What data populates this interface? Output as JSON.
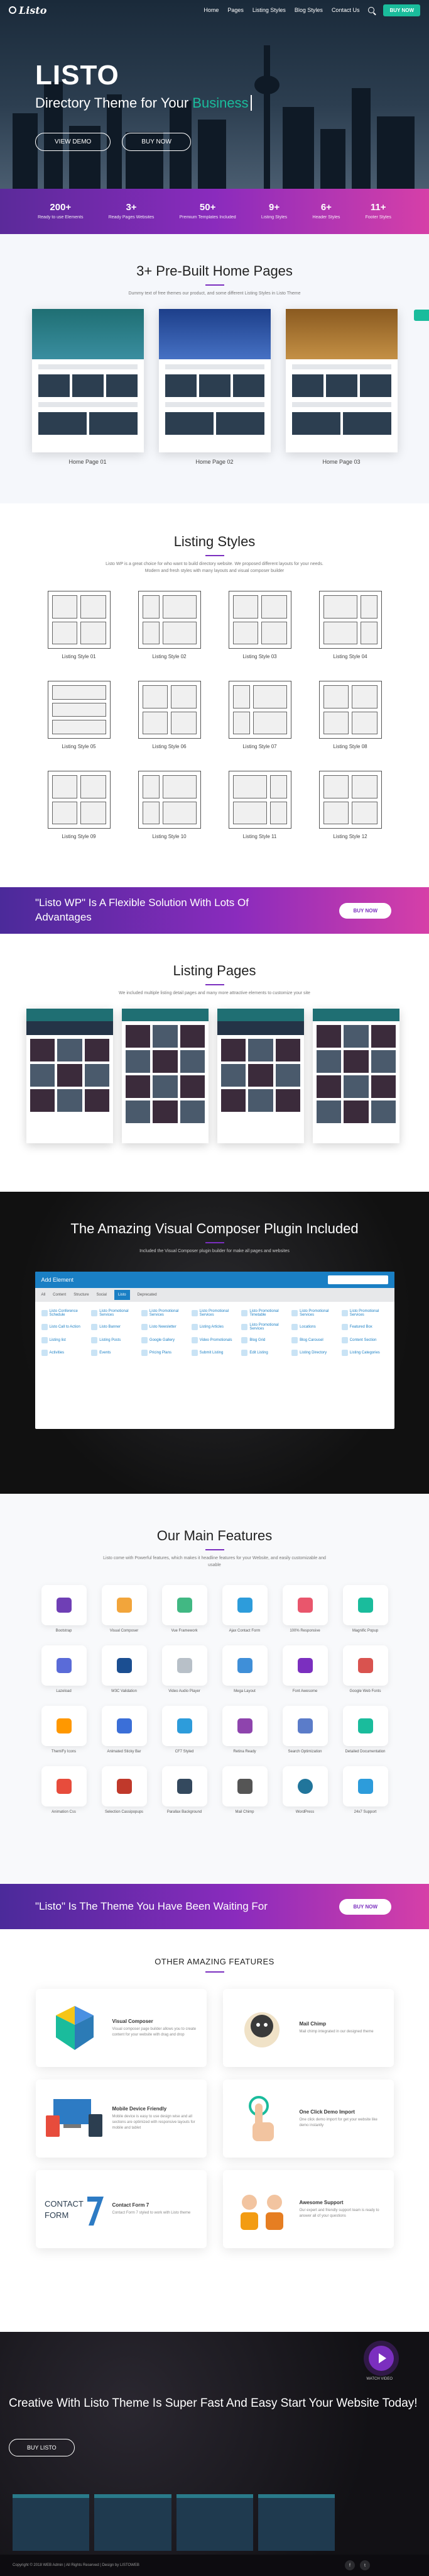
{
  "nav": {
    "logo": "Listo",
    "links": [
      "Home",
      "Pages",
      "Listing Styles",
      "Blog Styles",
      "Contact Us"
    ],
    "buy_label": "BUY NOW"
  },
  "hero": {
    "title": "LISTO",
    "subtitle": "Directory Theme for Your",
    "typed": "Business",
    "btn_demo": "VIEW DEMO",
    "btn_buy": "BUY NOW"
  },
  "stats": [
    {
      "n": "200+",
      "l": "Ready to use Elements"
    },
    {
      "n": "3+",
      "l": "Ready Pages Websites"
    },
    {
      "n": "50+",
      "l": "Premium Templates Included"
    },
    {
      "n": "9+",
      "l": "Listing Styles"
    },
    {
      "n": "6+",
      "l": "Header Styles"
    },
    {
      "n": "11+",
      "l": "Footer Styles"
    }
  ],
  "homepages": {
    "title": "3+ Pre-Built Home Pages",
    "desc": "Dummy text of free themes our product, and some different Listing Styles in Listo Theme",
    "items": [
      "Home Page 01",
      "Home Page 02",
      "Home Page 03"
    ]
  },
  "listing_styles": {
    "title": "Listing Styles",
    "desc": "Listo WP is a great choice for who want to build directory website. We proposed different layouts for your needs. Modern and fresh styles with many layouts and visual composer builder",
    "items": [
      "Listing Style 01",
      "Listing Style 02",
      "Listing Style 03",
      "Listing Style 04",
      "Listing Style 05",
      "Listing Style 06",
      "Listing Style 07",
      "Listing Style 08",
      "Listing Style 09",
      "Listing Style 10",
      "Listing Style 11",
      "Listing Style 12"
    ]
  },
  "cta1": {
    "text": "\"Listo WP\" Is A Flexible Solution With Lots Of Advantages",
    "btn": "BUY NOW"
  },
  "listing_pages": {
    "title": "Listing Pages",
    "desc": "We included multiple listing detail pages and many more attractive elements to customize your site"
  },
  "composer": {
    "title": "The Amazing Visual Composer Plugin Included",
    "desc": "Included the Visual Composer plugin builder for make all pages and websites",
    "window_title": "Add Element",
    "tabs": [
      "All",
      "Content",
      "Structure",
      "Social",
      "Listo",
      "Deprecated"
    ],
    "items": [
      "Listo Conference Schedule",
      "Listo Promotional Services",
      "Listo Promotional Services",
      "Listo Promotional Services",
      "Listo Promotional Timetable",
      "Listo Promotional Services",
      "Listo Promotional Services",
      "Listo Call to Action",
      "Listo Banner",
      "Listo Newsletter",
      "Listing Articles",
      "Listo Promotional Services",
      "Locations",
      "Featured Box",
      "Listing list",
      "Listing Posts",
      "Google Gallery",
      "Video Promotionals",
      "Blog Grid",
      "Blog Carousel",
      "Content Section",
      "Activities",
      "Events",
      "Pricing Plans",
      "Submit Listing",
      "Edit Listing",
      "Listing Directory",
      "Listing Categories"
    ]
  },
  "features": {
    "title": "Our Main Features",
    "desc": "Listo come with Powerful features, which makes it headline features for your Website, and easily customizable and usable",
    "items": [
      "Bootstrap",
      "Visual Composer",
      "Vue Framework",
      "Ajax Contact Form",
      "100% Responsive",
      "Magnific Popup",
      "Lazeload",
      "W3C Validation",
      "Video Audio Player",
      "Mega Layout",
      "Font Awesome",
      "Google Web Fonts",
      "ThemiFy Icons",
      "Animated Sticky Bar",
      "CF7 Styled",
      "Retina Ready",
      "Search Optimization",
      "Detailed Documentation",
      "Animation Css",
      "Selection Cassipopups",
      "Parallax Background",
      "Mail Chimp",
      "WordPress",
      "24x7 Support"
    ]
  },
  "cta2": {
    "text": "\"Listo\" Is The Theme You Have Been Waiting For",
    "btn": "BUY NOW"
  },
  "other": {
    "title": "OTHER AMAZING FEATURES",
    "items": [
      {
        "title": "Visual Composer",
        "desc": "Visual composer page builder allows you to create content for your website with drag and drop"
      },
      {
        "title": "Mail Chimp",
        "desc": "Mail chimp integrated in our designed theme"
      },
      {
        "title": "Mobile Device Friendly",
        "desc": "Mobile device is easy to use design wise and all sections are optimized with responsive layouts for mobile and tablet"
      },
      {
        "title": "One Click Demo Import",
        "desc": "One click demo import for get your website like demo instantly"
      },
      {
        "title": "Contact Form 7",
        "desc": "Contact Form 7 styled to work with Listo theme"
      },
      {
        "title": "Awesome Support",
        "desc": "Our expert and friendly support team is ready to answer all of your questions"
      }
    ]
  },
  "final": {
    "watch": "WATCH VIDEO",
    "title": "Creative With Listo Theme Is Super Fast And Easy Start Your Website Today!",
    "btn": "BUY LISTO",
    "copyright": "Copyright © 2018 WEB Admin | All Rights Reserved | Design by LISTOWEB"
  },
  "colors": {
    "accent": "#1abc9c",
    "purple": "#7b2fbf",
    "pink": "#d63fa8"
  }
}
